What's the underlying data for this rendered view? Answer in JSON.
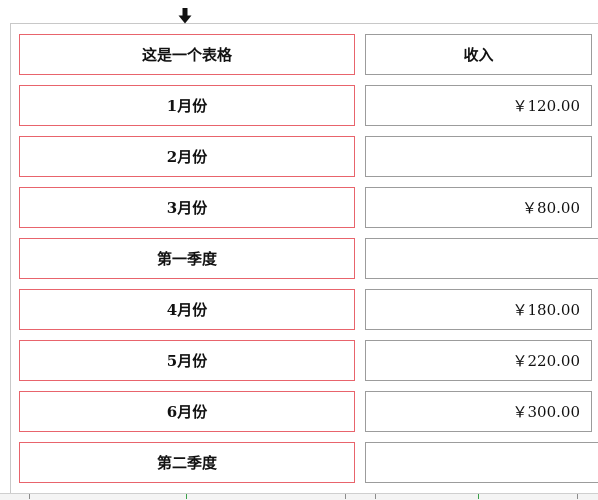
{
  "table": {
    "header": {
      "label": "这是一个表格",
      "value": "收入"
    },
    "rows": [
      {
        "label": "1月份",
        "value": "￥120.00"
      },
      {
        "label": "2月份",
        "value": ""
      },
      {
        "label": "3月份",
        "value": "￥80.00"
      },
      {
        "label": "第一季度",
        "value": ""
      },
      {
        "label": "4月份",
        "value": "￥180.00"
      },
      {
        "label": "5月份",
        "value": "￥220.00"
      },
      {
        "label": "6月份",
        "value": "￥300.00"
      },
      {
        "label": "第二季度",
        "value": ""
      }
    ]
  },
  "colors": {
    "label_border": "#e8646c",
    "value_border": "#9c9c9c",
    "grid_line": "#c8c8c8"
  },
  "icons": {
    "insert_marker": "arrow-down-icon"
  }
}
